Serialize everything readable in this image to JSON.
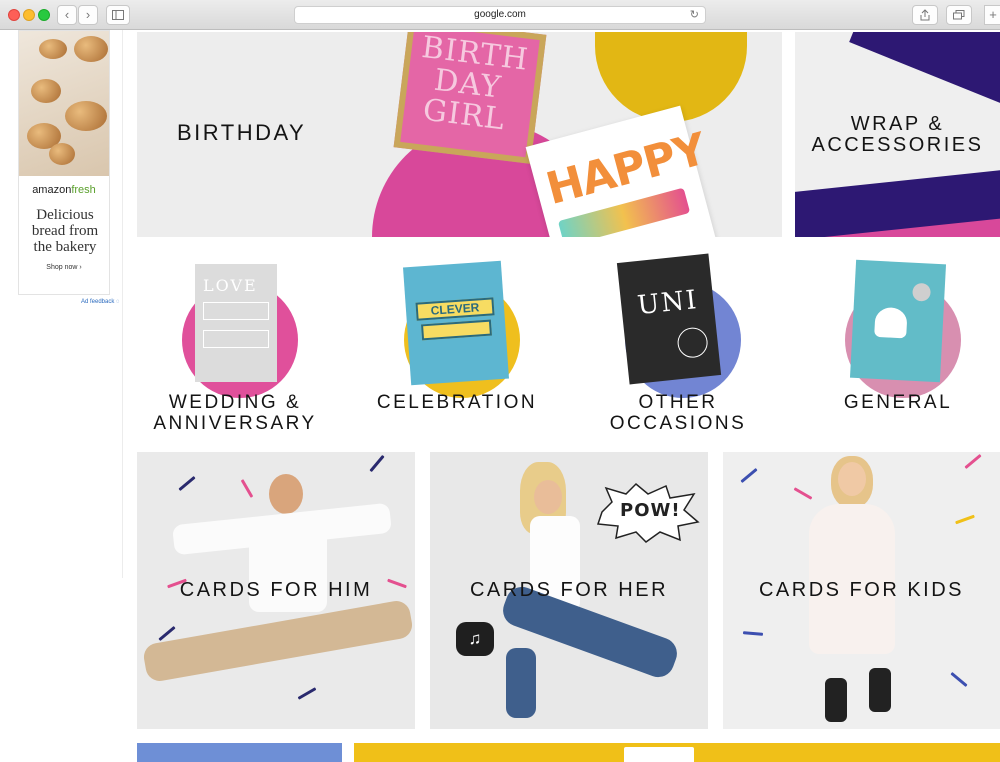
{
  "browser": {
    "url": "google.com"
  },
  "ad": {
    "brand_prefix": "amazon",
    "brand_suffix": "fresh",
    "copy": "Delicious bread from the bakery",
    "cta": "Shop now",
    "cta_arrow": "›",
    "feedback": "Ad feedback"
  },
  "banners": {
    "birthday": {
      "label": "BIRTHDAY",
      "card_text": "BIRTH DAY GIRL",
      "card2_text": "HAPPY"
    },
    "wrap": {
      "label_line1": "WRAP &",
      "label_line2": "ACCESSORIES"
    }
  },
  "occasions": [
    {
      "line1": "WEDDING &",
      "line2": "ANNIVERSARY",
      "card_text": "LOVE",
      "circle_color": "#e0509b"
    },
    {
      "line1": "",
      "line2": "CELEBRATION",
      "card_text": "CLEVER",
      "circle_color": "#efbf1e"
    },
    {
      "line1": "OTHER",
      "line2": "OCCASIONS",
      "card_text": "UNI",
      "circle_color": "#7285d3"
    },
    {
      "line1": "",
      "line2": "GENERAL",
      "card_text": "",
      "circle_color": "#d88fb0"
    }
  ],
  "audience": {
    "him": "CARDS FOR HIM",
    "her": "CARDS FOR HER",
    "kids": "CARDS FOR KIDS",
    "pow": "POW!"
  },
  "colors": {
    "pink": "#e0509b",
    "yellow": "#f0c018",
    "blue": "#6e8fd6",
    "navy": "#2a1a6e"
  }
}
